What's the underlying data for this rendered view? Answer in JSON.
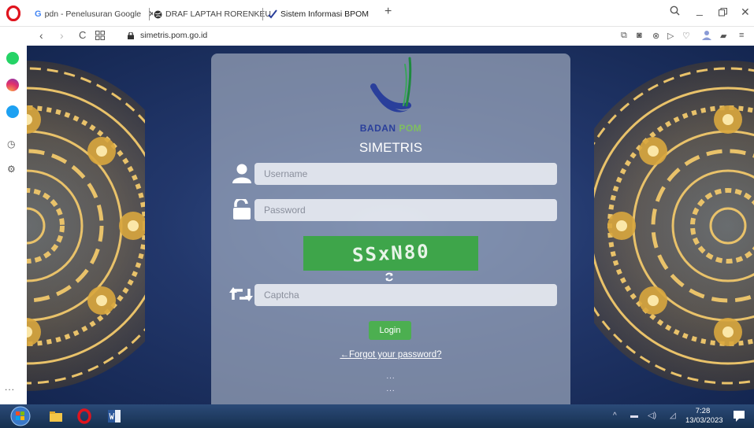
{
  "browser": {
    "tabs": [
      {
        "label": "pdn - Penelusuran Google",
        "favicon": "google-icon"
      },
      {
        "label": "DRAF LAPTAH RORENKEU",
        "favicon": "globe-icon"
      },
      {
        "label": "Sistem Informasi BPOM",
        "favicon": "check-icon"
      }
    ],
    "new_tab": "+",
    "url": "simetris.pom.go.id"
  },
  "login": {
    "brand_left": "BADAN",
    "brand_right": "POM",
    "app_title": "SIMETRIS",
    "username_placeholder": "Username",
    "password_placeholder": "Password",
    "captcha_text": "SSxN80",
    "captcha_placeholder": "Captcha",
    "login_label": "Login",
    "forgot_label": "←Forgot your password?",
    "dots": "..."
  },
  "sidebar": {
    "more": "..."
  },
  "taskbar": {
    "time": "7:28",
    "date": "13/03/2023"
  },
  "colors": {
    "captcha_bg": "#3ea54a",
    "login_btn": "#4caf50",
    "page_bg": "#22376b"
  }
}
